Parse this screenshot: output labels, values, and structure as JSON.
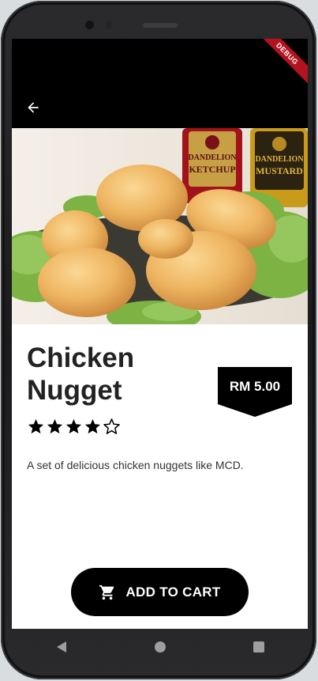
{
  "app": {
    "debug_label": "DEBUG"
  },
  "hero_image": {
    "description_icon": "chicken-nugget-photo",
    "bottles": [
      {
        "brand": "DANDELION",
        "product": "KETCHUP"
      },
      {
        "brand": "DANDELION",
        "product": "MUSTARD"
      }
    ]
  },
  "product": {
    "name": "Chicken Nugget",
    "price": "RM 5.00",
    "rating": 4,
    "rating_max": 5,
    "description": "A set of delicious chicken nuggets like MCD."
  },
  "actions": {
    "add_to_cart_label": "ADD TO CART"
  },
  "icons": {
    "back": "arrow-back-icon",
    "cart": "shopping-cart-icon",
    "nav_back": "nav-back-icon",
    "nav_home": "nav-home-icon",
    "nav_recents": "nav-recents-icon"
  },
  "colors": {
    "price_tag": "#000000",
    "button": "#000000",
    "debug_banner": "#b3121f"
  }
}
